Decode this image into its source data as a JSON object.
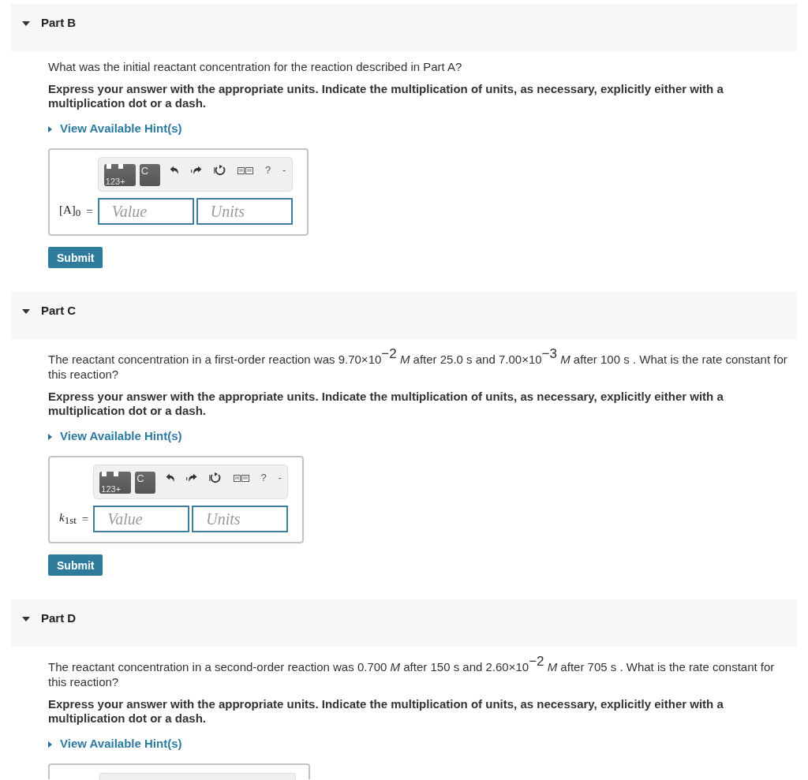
{
  "parts": [
    {
      "title": "Part B",
      "expanded": true,
      "question": "What was the initial reactant concentration for the reaction described in Part A?",
      "instruction": "Express your answer with the appropriate units. Indicate the multiplication of units, as necessary, explicitly either with a multiplication dot or a dash.",
      "hint_link": "View Available Hint(s)",
      "answer": {
        "toolbar": [
          {
            "kind": "template",
            "label": "123+"
          },
          {
            "kind": "template",
            "label": "C"
          },
          {
            "kind": "undo"
          },
          {
            "kind": "redo"
          },
          {
            "kind": "reset"
          },
          {
            "kind": "keyboard"
          },
          {
            "kind": "help",
            "label": "?"
          },
          {
            "kind": "more",
            "label": "-"
          }
        ],
        "label": "[A]$_{0}$",
        "relation": "=",
        "value": {
          "placeholder": "Value"
        },
        "units": {
          "placeholder": "Units"
        }
      },
      "submit": "Submit"
    },
    {
      "title": "Part C",
      "expanded": true,
      "question": "The reactant concentration in a first-order reaction was 9.70×10$^{−2}$ *M* after 25.0 s and 7.00×10$^{−3}$ *M* after 100 s . What is the rate constant for this reaction?",
      "instruction": "Express your answer with the appropriate units. Indicate the multiplication of units, as necessary, explicitly either with a multiplication dot or a dash.",
      "hint_link": "View Available Hint(s)",
      "answer": {
        "toolbar": [
          {
            "kind": "template",
            "label": "123+"
          },
          {
            "kind": "template",
            "label": "C"
          },
          {
            "kind": "undo"
          },
          {
            "kind": "redo"
          },
          {
            "kind": "reset"
          },
          {
            "kind": "keyboard"
          },
          {
            "kind": "help",
            "label": "?"
          },
          {
            "kind": "more",
            "label": "-"
          }
        ],
        "label": "*k*$_{1st}$",
        "relation": "=",
        "value": {
          "placeholder": "Value"
        },
        "units": {
          "placeholder": "Units"
        }
      },
      "submit": "Submit"
    },
    {
      "title": "Part D",
      "expanded": true,
      "question": "The reactant concentration in a second-order reaction was 0.700 *M* after 150 s and 2.60×10$^{−2}$ *M* after 705 s . What is the rate constant for this reaction?",
      "instruction": "Express your answer with the appropriate units. Indicate the multiplication of units, as necessary, explicitly either with a multiplication dot or a dash.",
      "hint_link": "View Available Hint(s)",
      "answer": {
        "cut_off": true
      }
    }
  ]
}
